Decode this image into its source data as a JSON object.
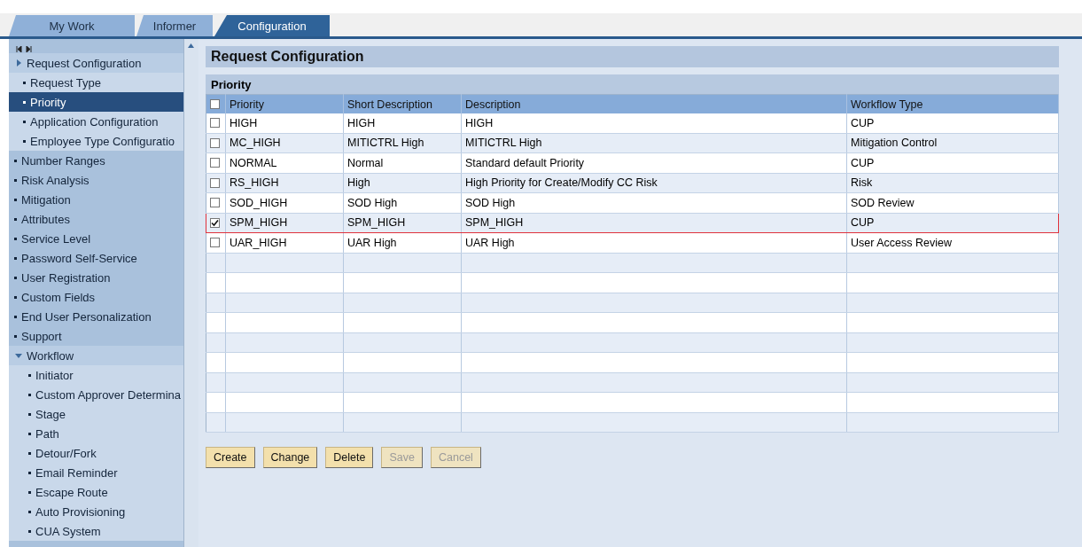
{
  "tabs": [
    {
      "label": "My Work",
      "selected": false
    },
    {
      "label": "Informer",
      "selected": false
    },
    {
      "label": "Configuration",
      "selected": true
    }
  ],
  "sidebar": {
    "items": [
      {
        "label": "Request Configuration",
        "expanded": false,
        "selected": false,
        "children": [
          {
            "label": "Request Type",
            "selected": false
          },
          {
            "label": "Priority",
            "selected": true
          },
          {
            "label": "Application Configuration",
            "selected": false
          },
          {
            "label": "Employee Type Configuratio",
            "selected": false
          }
        ]
      },
      {
        "label": "Number Ranges",
        "selected": false
      },
      {
        "label": "Risk Analysis",
        "selected": false
      },
      {
        "label": "Mitigation",
        "selected": false
      },
      {
        "label": "Attributes",
        "selected": false
      },
      {
        "label": "Service Level",
        "selected": false
      },
      {
        "label": "Password Self-Service",
        "selected": false
      },
      {
        "label": "User Registration",
        "selected": false
      },
      {
        "label": "Custom Fields",
        "selected": false
      },
      {
        "label": "End User Personalization",
        "selected": false
      },
      {
        "label": "Support",
        "selected": false
      },
      {
        "label": "Workflow",
        "expanded": true,
        "selected": false,
        "children": [
          {
            "label": "Initiator",
            "selected": false
          },
          {
            "label": "Custom Approver Determina",
            "selected": false
          },
          {
            "label": "Stage",
            "selected": false
          },
          {
            "label": "Path",
            "selected": false
          },
          {
            "label": "Detour/Fork",
            "selected": false
          },
          {
            "label": "Email Reminder",
            "selected": false
          },
          {
            "label": "Escape Route",
            "selected": false
          },
          {
            "label": "Auto Provisioning",
            "selected": false
          },
          {
            "label": "CUA System",
            "selected": false
          }
        ]
      }
    ]
  },
  "page_title": "Request Configuration",
  "table": {
    "title": "Priority",
    "all_checked": false,
    "columns": [
      "Priority",
      "Short Description",
      "Description",
      "Workflow Type"
    ],
    "rows": [
      {
        "cells": [
          "HIGH",
          "HIGH",
          "HIGH",
          "CUP"
        ],
        "checked": false,
        "selected": false
      },
      {
        "cells": [
          "MC_HIGH",
          "MITICTRL High",
          "MITICTRL High",
          "Mitigation Control"
        ],
        "checked": false,
        "selected": false
      },
      {
        "cells": [
          "NORMAL",
          "Normal",
          "Standard default Priority",
          "CUP"
        ],
        "checked": false,
        "selected": false
      },
      {
        "cells": [
          "RS_HIGH",
          "High",
          "High Priority for Create/Modify CC Risk",
          "Risk"
        ],
        "checked": false,
        "selected": false
      },
      {
        "cells": [
          "SOD_HIGH",
          "SOD High",
          "SOD High",
          "SOD Review"
        ],
        "checked": false,
        "selected": false
      },
      {
        "cells": [
          "SPM_HIGH",
          "SPM_HIGH",
          "SPM_HIGH",
          "CUP"
        ],
        "checked": true,
        "selected": true
      },
      {
        "cells": [
          "UAR_HIGH",
          "UAR High",
          "UAR High",
          "User Access Review"
        ],
        "checked": false,
        "selected": false
      }
    ]
  },
  "buttons": [
    {
      "label": "Create",
      "disabled": false
    },
    {
      "label": "Change",
      "disabled": false
    },
    {
      "label": "Delete",
      "disabled": false
    },
    {
      "label": "Save",
      "disabled": true
    },
    {
      "label": "Cancel",
      "disabled": true
    }
  ]
}
